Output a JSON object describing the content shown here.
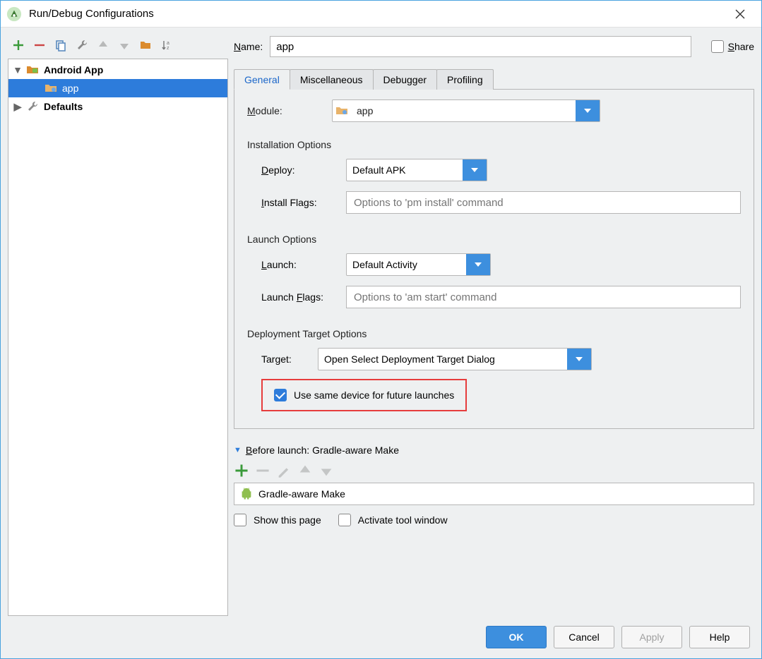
{
  "window": {
    "title": "Run/Debug Configurations"
  },
  "tree": {
    "root1": {
      "label": "Android App"
    },
    "app": {
      "label": "app"
    },
    "root2": {
      "label": "Defaults"
    }
  },
  "name": {
    "label_prefix": "N",
    "label_rest": "ame:",
    "value": "app"
  },
  "share": {
    "label_prefix": "S",
    "label_rest": "hare"
  },
  "tabs": {
    "general": "General",
    "misc": "Miscellaneous",
    "debugger": "Debugger",
    "profiling": "Profiling"
  },
  "general": {
    "module_label_prefix": "M",
    "module_label_rest": "odule:",
    "module_value": "app",
    "install_head": "Installation Options",
    "deploy_label": "Deploy:",
    "deploy_label_u": "D",
    "deploy_label_rest": "eploy:",
    "deploy_value": "Default APK",
    "install_flags_label": "Install Flags:",
    "install_flags_u": "I",
    "install_flags_rest": "nstall Flags:",
    "install_flags_placeholder": "Options to 'pm install' command",
    "launch_head": "Launch Options",
    "launch_label_u": "L",
    "launch_label_rest": "aunch:",
    "launch_value": "Default Activity",
    "launch_flags_label": "Launch Flags:",
    "launch_flags_u": "F",
    "launch_flags_pre": "Launch ",
    "launch_flags_rest": "lags:",
    "launch_flags_placeholder": "Options to 'am start' command",
    "dto_head": "Deployment Target Options",
    "target_label": "Target:",
    "target_value": "Open Select Deployment Target Dialog",
    "same_device_label": "Use same device for future launches"
  },
  "before_launch": {
    "head_u": "B",
    "head_rest": "efore launch: Gradle-aware Make",
    "item": "Gradle-aware Make",
    "show_page": "Show this page",
    "activate_tool": "Activate tool window"
  },
  "footer": {
    "ok": "OK",
    "cancel": "Cancel",
    "apply": "Apply",
    "help": "Help"
  }
}
